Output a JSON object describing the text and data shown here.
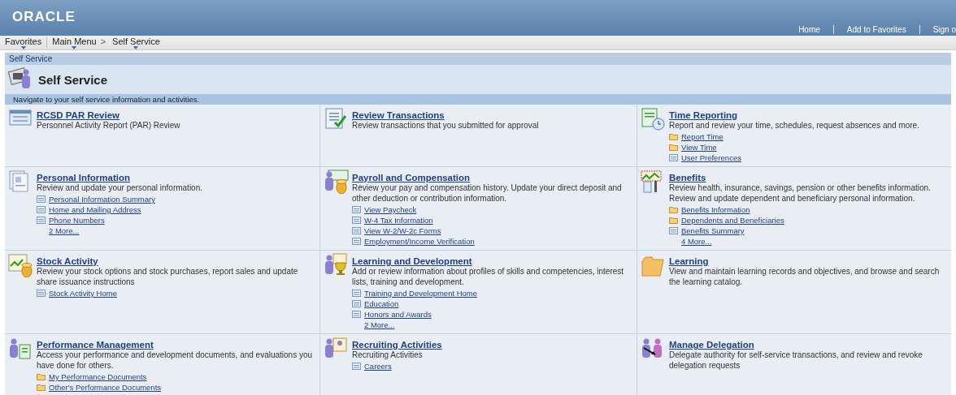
{
  "header": {
    "logo": "ORACLE",
    "links": [
      "Home",
      "Add to Favorites",
      "Sign o"
    ]
  },
  "menu_bar": {
    "items": [
      "Favorites",
      "Main Menu",
      "Self Service"
    ],
    "separator": ">"
  },
  "breadcrumb": "Self Service",
  "page": {
    "title": "Self Service",
    "description": "Navigate to your self service information and activities."
  },
  "tiles": [
    {
      "title": "RCSD PAR Review",
      "description": "Personnel Activity Report (PAR) Review"
    },
    {
      "title": "Review Transactions",
      "description": "Review transactions that you submitted for approval"
    },
    {
      "title": "Time Reporting",
      "description": "Report and review your time, schedules, request absences and more.",
      "links": [
        {
          "kind": "folder",
          "label": "Report Time"
        },
        {
          "kind": "folder",
          "label": "View Time"
        },
        {
          "kind": "page",
          "label": "User Preferences"
        }
      ]
    },
    {
      "title": "Personal Information",
      "description": "Review and update your personal information.",
      "links": [
        {
          "kind": "page",
          "label": "Personal Information Summary"
        },
        {
          "kind": "page",
          "label": "Home and Mailing Address"
        },
        {
          "kind": "page",
          "label": "Phone Numbers"
        },
        {
          "kind": "more",
          "label": "2 More..."
        }
      ]
    },
    {
      "title": "Payroll and Compensation",
      "description": "Review your pay and compensation history. Update your direct deposit and other deduction or contribution information.",
      "links": [
        {
          "kind": "page",
          "label": "View Paycheck"
        },
        {
          "kind": "page",
          "label": "W-4 Tax Information"
        },
        {
          "kind": "page",
          "label": "View W-2/W-2c Forms"
        },
        {
          "kind": "page",
          "label": "Employment/Income Verification"
        }
      ]
    },
    {
      "title": "Benefits",
      "description": "Review health, insurance, savings, pension or other benefits information. Review and update dependent and beneficiary personal information.",
      "links": [
        {
          "kind": "folder",
          "label": "Benefits Information"
        },
        {
          "kind": "folder",
          "label": "Dependents and Beneficiaries"
        },
        {
          "kind": "page",
          "label": "Benefits Summary"
        },
        {
          "kind": "more",
          "label": "4 More..."
        }
      ]
    },
    {
      "title": "Stock Activity",
      "description": "Review your stock options and stock purchases, report sales and update share issuance instructions",
      "links": [
        {
          "kind": "page",
          "label": "Stock Activity Home"
        }
      ]
    },
    {
      "title": "Learning and Development",
      "description": "Add or review information about profiles of skills and competencies, interest lists, training and development.",
      "links": [
        {
          "kind": "page",
          "label": "Training and Development Home"
        },
        {
          "kind": "page",
          "label": "Education"
        },
        {
          "kind": "page",
          "label": "Honors and Awards"
        },
        {
          "kind": "more",
          "label": "2 More..."
        }
      ]
    },
    {
      "title": "Learning",
      "description": "View and maintain learning records and objectives, and browse and search the learning catalog."
    },
    {
      "title": "Performance Management",
      "description": "Access your performance and development documents, and evaluations you have done for others.",
      "links": [
        {
          "kind": "folder",
          "label": "My Performance Documents"
        },
        {
          "kind": "folder",
          "label": "Other's Performance Documents"
        }
      ]
    },
    {
      "title": "Recruiting Activities",
      "description": "Recruiting Activities",
      "links": [
        {
          "kind": "page",
          "label": "Careers"
        }
      ]
    },
    {
      "title": "Manage Delegation",
      "description": "Delegate authority for self-service transactions, and review and revoke delegation requests"
    }
  ]
}
